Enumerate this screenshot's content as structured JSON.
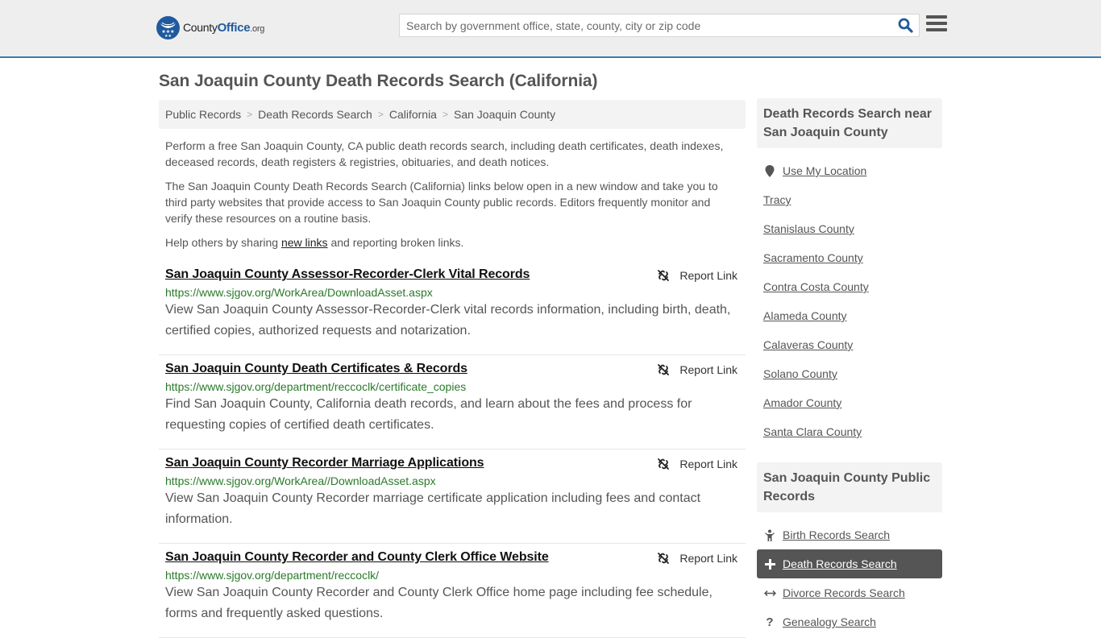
{
  "header": {
    "logo": {
      "name": "County",
      "highlight": "Office",
      "tld": ".org"
    },
    "search": {
      "placeholder": "Search by government office, state, county, city or zip code",
      "value": ""
    },
    "icons": {
      "search": "search-icon",
      "menu": "hamburger-menu-icon"
    }
  },
  "page": {
    "title": "San Joaquin County Death Records Search (California)",
    "breadcrumb": [
      "Public Records",
      "Death Records Search",
      "California",
      "San Joaquin County"
    ],
    "intro": {
      "p1": "Perform a free San Joaquin County, CA public death records search, including death certificates, death indexes, deceased records, death registers & registries, obituaries, and death notices.",
      "p2": "The San Joaquin County Death Records Search (California) links below open in a new window and take you to third party websites that provide access to San Joaquin County public records. Editors frequently monitor and verify these resources on a routine basis.",
      "p3_before": "Help others by sharing ",
      "p3_link": "new links",
      "p3_after": " and reporting broken links."
    },
    "report_label": "Report Link",
    "results": [
      {
        "title": "San Joaquin County Assessor-Recorder-Clerk Vital Records",
        "url": "https://www.sjgov.org/WorkArea/DownloadAsset.aspx",
        "desc": "View San Joaquin County Assessor-Recorder-Clerk vital records information, including birth, death, certified copies, authorized requests and notarization."
      },
      {
        "title": "San Joaquin County Death Certificates & Records",
        "url": "https://www.sjgov.org/department/reccoclk/certificate_copies",
        "desc": "Find San Joaquin County, California death records, and learn about the fees and process for requesting copies of certified death certificates."
      },
      {
        "title": "San Joaquin County Recorder Marriage Applications",
        "url": "https://www.sjgov.org/WorkArea//DownloadAsset.aspx",
        "desc": "View San Joaquin County Recorder marriage certificate application including fees and contact information."
      },
      {
        "title": "San Joaquin County Recorder and County Clerk Office Website",
        "url": "https://www.sjgov.org/department/reccoclk/",
        "desc": "View San Joaquin County Recorder and County Clerk Office home page including fee schedule, forms and frequently asked questions."
      }
    ]
  },
  "sidebar": {
    "nearby": {
      "heading": "Death Records Search near San Joaquin County",
      "use_location": "Use My Location",
      "items": [
        "Tracy",
        "Stanislaus County",
        "Sacramento County",
        "Contra Costa County",
        "Alameda County",
        "Calaveras County",
        "Solano County",
        "Amador County",
        "Santa Clara County"
      ]
    },
    "public_records": {
      "heading": "San Joaquin County Public Records",
      "items": [
        {
          "label": "Birth Records Search",
          "icon": "child-icon",
          "active": false
        },
        {
          "label": "Death Records Search",
          "icon": "plus-icon",
          "active": true
        },
        {
          "label": "Divorce Records Search",
          "icon": "arrows-horizontal-icon",
          "active": false
        },
        {
          "label": "Genealogy Search",
          "icon": "question-icon",
          "active": false
        }
      ]
    }
  },
  "colors": {
    "accent": "#1f5a9e",
    "header_border": "#3a7cb0",
    "url_green": "#2a7a2a",
    "active_bg": "#555555"
  }
}
